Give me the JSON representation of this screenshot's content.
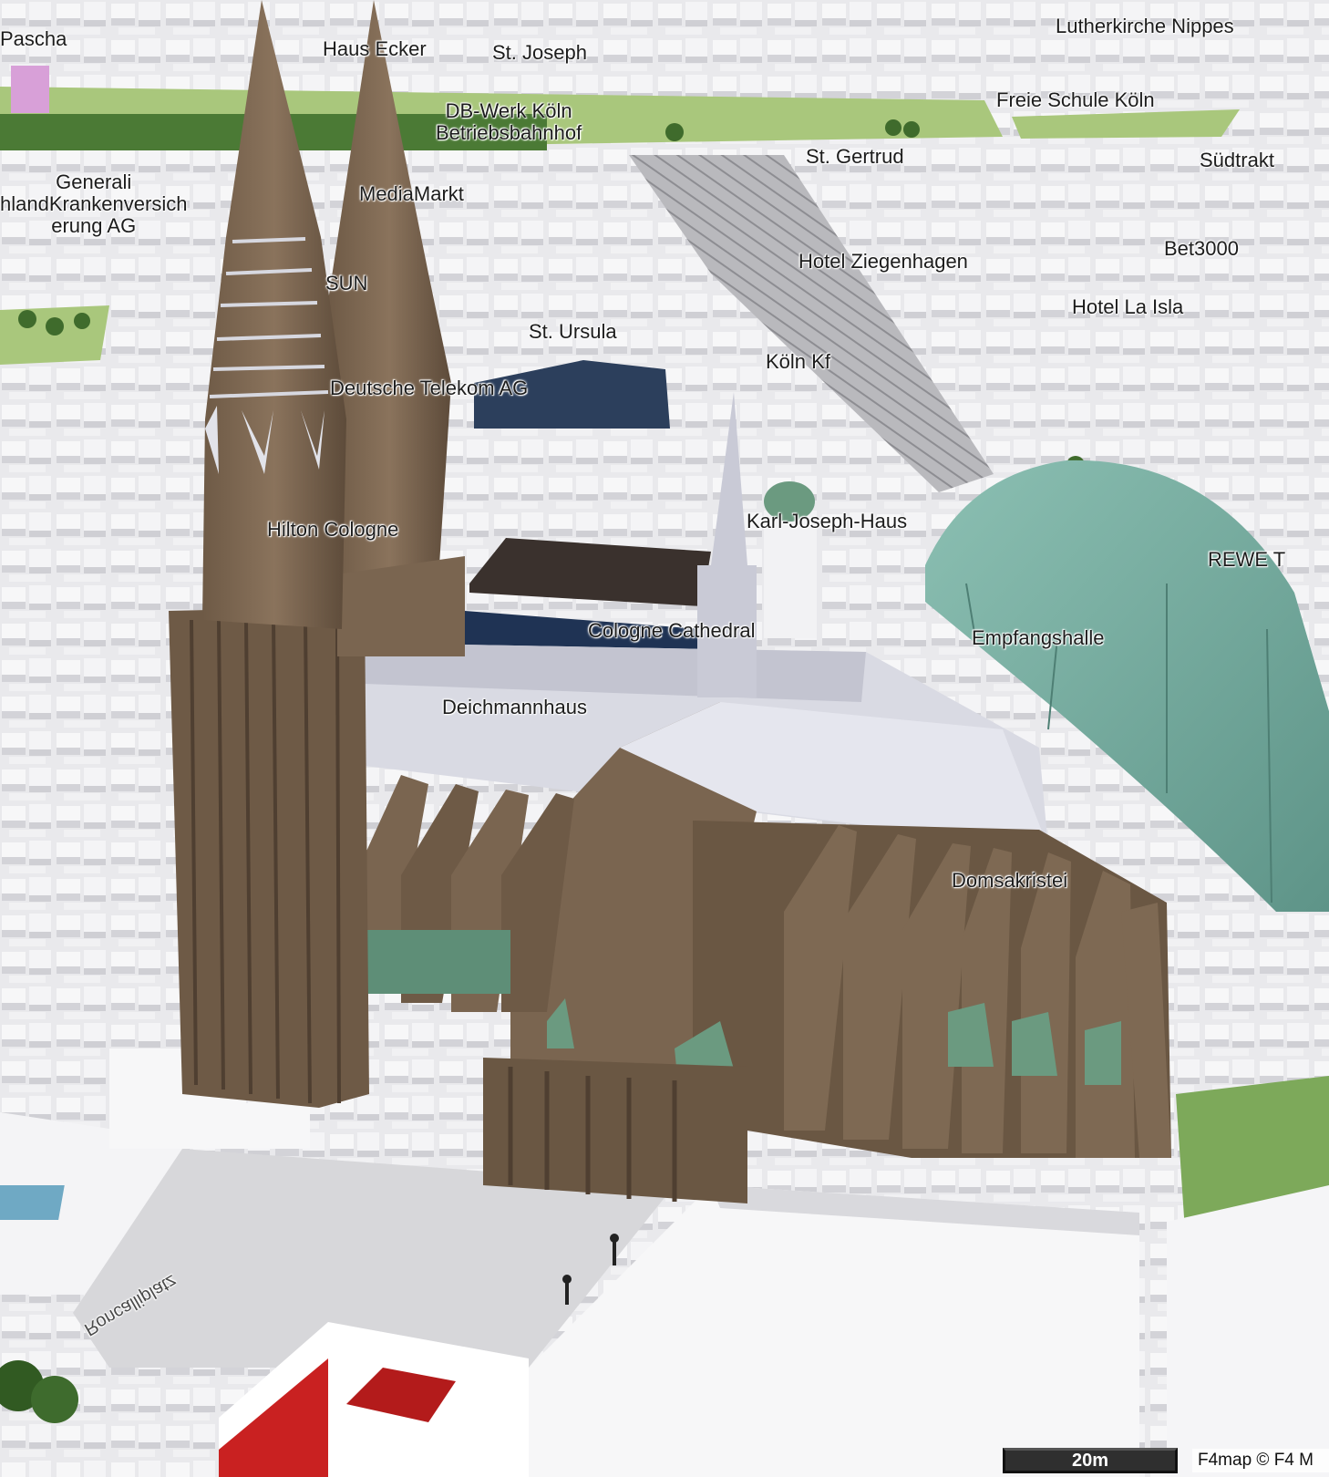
{
  "map": {
    "labels": {
      "pascha": "Pascha",
      "haus_ecker": "Haus Ecker",
      "st_joseph": "St. Joseph",
      "lutherkirche": "Lutherkirche Nippes",
      "db_werk_1": "DB-Werk Köln",
      "db_werk_2": "Betriebsbahnhof",
      "freie_schule": "Freie Schule Köln",
      "generali_1": "Generali",
      "generali_2": "hlandKrankenversich",
      "generali_3": "erung AG",
      "mediamarkt": "MediaMarkt",
      "st_gertrud": "St. Gertrud",
      "suedtrakt": "Südtrakt",
      "hotel_ziegenhagen": "Hotel Ziegenhagen",
      "bet3000": "Bet3000",
      "sun": "SUN",
      "hotel_la_isla": "Hotel La Isla",
      "st_ursula": "St. Ursula",
      "koeln_kf": "Köln Kf",
      "deutsche_telekom": "Deutsche Telekom AG",
      "karl_joseph": "Karl-Joseph-Haus",
      "hilton": "Hilton Cologne",
      "rewe": "REWE T",
      "cologne_cathedral": "Cologne Cathedral",
      "empfangshalle": "Empfangshalle",
      "deichmannhaus": "Deichmannhaus",
      "domsakristei": "Domsakristei",
      "roncalliplatz": "Roncalliplatz"
    }
  },
  "footer": {
    "scale": "20m",
    "attribution": "F4map © F4 M"
  },
  "colors": {
    "cathedral": "#7a6550",
    "cathedral_dark": "#5e4c3b",
    "roof": "#d8d9e2",
    "station_roof": "#7fb0a4",
    "grass": "#a8c878",
    "buildings": "#efefef",
    "ground": "#dcdcdf",
    "red_building": "#b31b1b",
    "navy_building": "#1f3354"
  }
}
